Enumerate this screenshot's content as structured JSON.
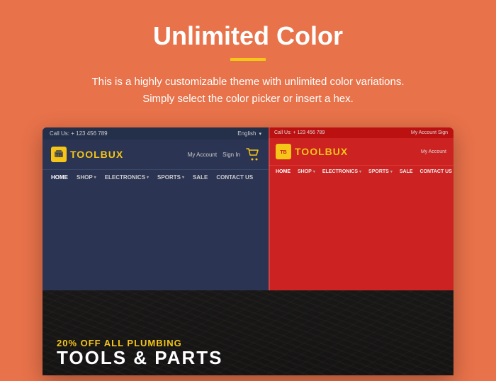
{
  "page": {
    "title": "Unlimited Color",
    "subtitle_line1": "This is a highly customizable theme with unlimited color variations.",
    "subtitle_line2": "Simply select the color picker or insert a hex.",
    "accent_color": "#f5c518",
    "bg_color": "#e8724a"
  },
  "browser": {
    "topbar": {
      "left": "Call Us: + 123 456 789",
      "right": "English"
    },
    "logo": {
      "text_part1": "TOOL",
      "text_part2": "BUX",
      "icon_label": "TB"
    },
    "logobar_right": {
      "my_account": "My Account",
      "sign_in": "Sign In"
    },
    "nav_items": [
      {
        "label": "HOME"
      },
      {
        "label": "SHOP",
        "has_dropdown": true
      },
      {
        "label": "ELECTRONICS",
        "has_dropdown": true
      },
      {
        "label": "SPORTS",
        "has_dropdown": true
      },
      {
        "label": "SALE"
      },
      {
        "label": "CONTACT US"
      }
    ],
    "right_panel": {
      "topbar_left": "Call Us: + 123 456 789",
      "topbar_right": "My Account  Sign",
      "nav_items": [
        {
          "label": "HOME"
        },
        {
          "label": "SHOP",
          "has_dropdown": true
        },
        {
          "label": "ELECTRONICS",
          "has_dropdown": true
        },
        {
          "label": "SPORTS",
          "has_dropdown": true
        },
        {
          "label": "SALE"
        },
        {
          "label": "CONTACT US"
        }
      ]
    },
    "promo": {
      "line1_prefix": "20% OFF",
      "line1_suffix": "ALL PLUMBING",
      "line2": "TOOLS & PARTS"
    }
  }
}
